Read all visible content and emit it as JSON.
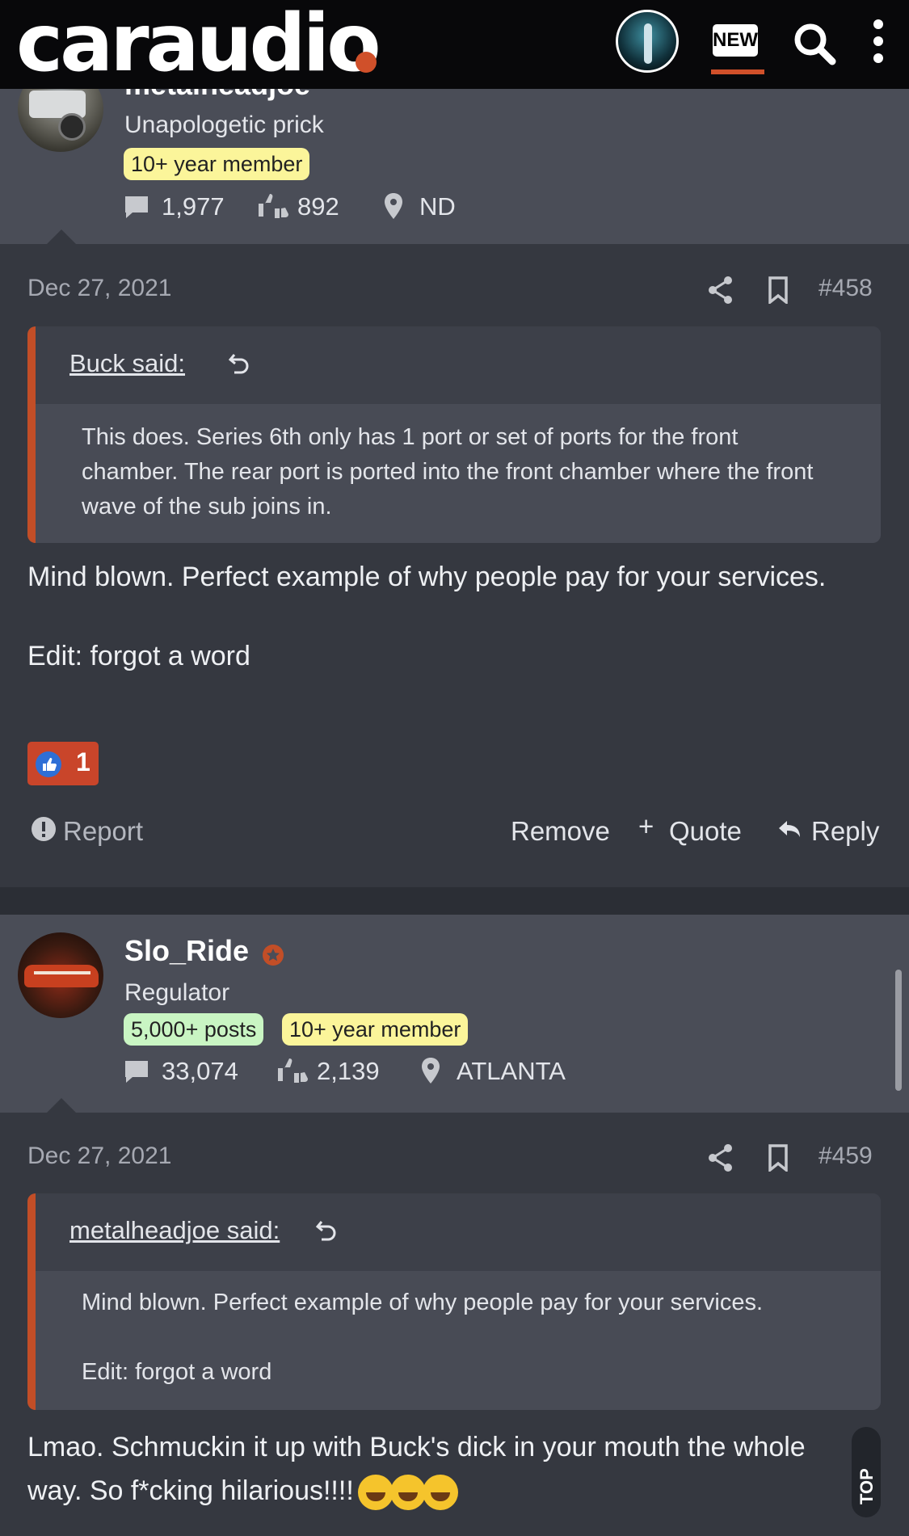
{
  "header": {
    "logo_text": "caraudio",
    "new_label": "NEW",
    "accent_color": "#d0502a"
  },
  "user1": {
    "name": "metalheadjoe",
    "title": "Unapologetic prick",
    "badge": "10+ year member",
    "messages": "1,977",
    "reactions": "892",
    "location": "ND"
  },
  "post1": {
    "date": "Dec 27, 2021",
    "number": "#458",
    "quote_author": "Buck said:",
    "quote_text": "This does. Series 6th only has 1 port or set of ports for the front chamber. The rear port is ported into the front chamber where the front wave of the sub joins in.",
    "message_line1": "Mind blown. Perfect example of why people pay for your services.",
    "message_line2": "Edit: forgot a word",
    "reaction_count": "1",
    "actions": {
      "report": "Report",
      "remove": "Remove",
      "quote": "Quote",
      "reply": "Reply"
    }
  },
  "user2": {
    "name": "Slo_Ride",
    "title": "Regulator",
    "badge_posts": "5,000+ posts",
    "badge_member": "10+ year member",
    "messages": "33,074",
    "reactions": "2,139",
    "location": "ATLANTA"
  },
  "post2": {
    "date": "Dec 27, 2021",
    "number": "#459",
    "quote_author": "metalheadjoe said:",
    "quote_line1": "Mind blown. Perfect example of why people pay for your services.",
    "quote_line2": "Edit: forgot a word",
    "message": "Lmao. Schmuckin it up with Buck's dick in your mouth the whole way. So f*cking hilarious!!!!"
  },
  "top_button": "TOP"
}
